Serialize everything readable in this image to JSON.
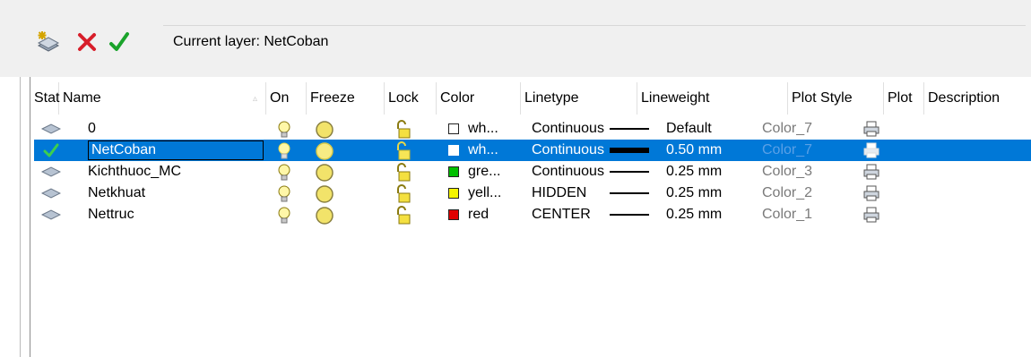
{
  "toolbar": {
    "new_layer_icon": "new-layer-icon",
    "delete_layer_icon": "delete-layer-icon",
    "set_current_icon": "set-current-icon",
    "current_layer_label": "Current layer: NetCoban"
  },
  "columns": {
    "status": "Stat",
    "name": "Name",
    "on": "On",
    "freeze": "Freeze",
    "lock": "Lock",
    "color": "Color",
    "linetype": "Linetype",
    "lineweight": "Lineweight",
    "plot_style": "Plot Style",
    "plot": "Plot",
    "description": "Description"
  },
  "rows": [
    {
      "name": "0",
      "color_swatch": "#ffffff",
      "color_name": "wh...",
      "linetype": "Continuous",
      "lineweight": "Default",
      "plot_style": "Color_7",
      "selected": false
    },
    {
      "name": "NetCoban",
      "color_swatch": "#ffffff",
      "color_name": "wh...",
      "linetype": "Continuous",
      "lineweight": "0.50 mm",
      "plot_style": "Color_7",
      "selected": true
    },
    {
      "name": "Kichthuoc_MC",
      "color_swatch": "#00c000",
      "color_name": "gre...",
      "linetype": "Continuous",
      "lineweight": "0.25 mm",
      "plot_style": "Color_3",
      "selected": false
    },
    {
      "name": "Netkhuat",
      "color_swatch": "#f5f500",
      "color_name": "yell...",
      "linetype": "HIDDEN",
      "lineweight": "0.25 mm",
      "plot_style": "Color_2",
      "selected": false
    },
    {
      "name": "Nettruc",
      "color_swatch": "#e00000",
      "color_name": "red",
      "linetype": "CENTER",
      "lineweight": "0.25 mm",
      "plot_style": "Color_1",
      "selected": false
    }
  ],
  "colors": {
    "selection": "#0078d7",
    "toolbar_bg": "#f0f0f0"
  }
}
